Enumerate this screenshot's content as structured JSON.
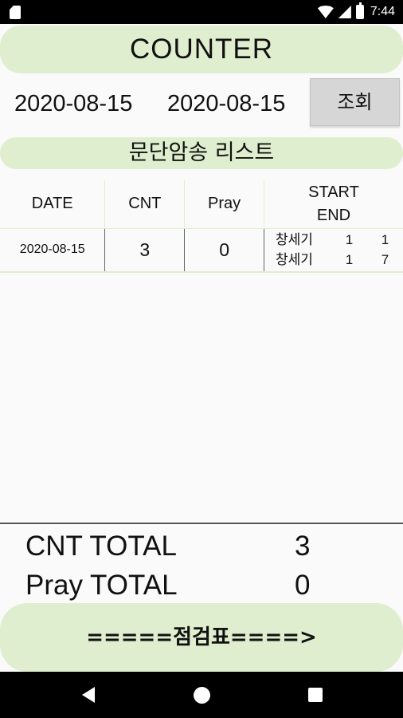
{
  "status_bar": {
    "time": "7:44",
    "battery_label": "B"
  },
  "header": {
    "title": "COUNTER"
  },
  "date_range": {
    "from": "2020-08-15",
    "to": "2020-08-15",
    "query_label": "조회"
  },
  "list": {
    "title": "문단암송 리스트",
    "columns": {
      "date": "DATE",
      "cnt": "CNT",
      "pray": "Pray",
      "start": "START",
      "end": "END"
    },
    "rows": [
      {
        "date": "2020-08-15",
        "cnt": "3",
        "pray": "0",
        "start": {
          "book": "창세기",
          "chapter": "1",
          "verse": "1"
        },
        "end": {
          "book": "창세기",
          "chapter": "1",
          "verse": "7"
        }
      }
    ]
  },
  "totals": {
    "cnt_label": "CNT TOTAL",
    "cnt_value": "3",
    "pray_label": "Pray TOTAL",
    "pray_value": "0"
  },
  "check_button": {
    "label": "=====점검표====>"
  },
  "colors": {
    "accent": "#dfeece",
    "button_gray": "#d6d6d6",
    "bars": "#000000"
  }
}
